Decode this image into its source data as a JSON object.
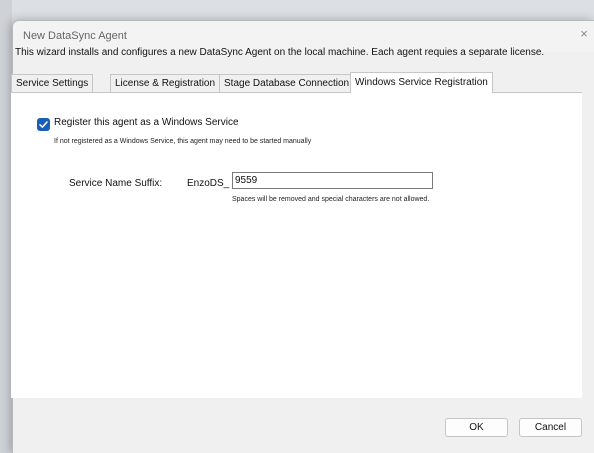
{
  "dialog": {
    "title": "New DataSync Agent",
    "close_glyph": "×",
    "intro": "This wizard installs and configures a new DataSync Agent on the local machine. Each agent requies a separate license."
  },
  "tabs": [
    {
      "label": "Service Settings",
      "active": false
    },
    {
      "label": "License & Registration",
      "active": false
    },
    {
      "label": "Stage Database Connection",
      "active": false
    },
    {
      "label": "Windows Service Registration",
      "active": true
    }
  ],
  "panel": {
    "register_checked": true,
    "register_label": "Register this agent as a Windows Service",
    "register_hint": "If not registered as a Windows Service, this agent may need to be started manually",
    "suffix_label": "Service Name Suffix:",
    "suffix_prefix": "EnzoDS_",
    "suffix_value": "9559",
    "suffix_hint": "Spaces will be removed and special characters are not allowed."
  },
  "buttons": {
    "ok": "OK",
    "cancel": "Cancel"
  },
  "colors": {
    "accent": "#1a5fb4",
    "dialog_bg": "#f0f0f0",
    "panel_bg": "#ffffff"
  }
}
